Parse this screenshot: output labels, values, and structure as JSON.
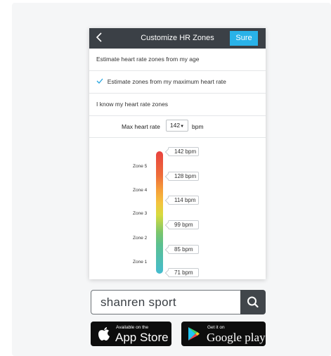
{
  "header": {
    "back_icon": "chevron-left-icon",
    "title": "Customize HR Zones",
    "sure_label": "Sure"
  },
  "options": [
    {
      "label": "Estimate heart rate zones from my age",
      "selected": false
    },
    {
      "label": "Estimate zones from my maximum heart rate",
      "selected": true
    },
    {
      "label": "I know my heart rate zones",
      "selected": false
    }
  ],
  "max_hr": {
    "label": "Max heart rate",
    "value": "142",
    "unit": "bpm"
  },
  "zones": [
    {
      "name": "Zone 5",
      "color": "#e8423f"
    },
    {
      "name": "Zone 4",
      "color": "#f6a13a"
    },
    {
      "name": "Zone 3",
      "color": "#d7db3f"
    },
    {
      "name": "Zone 2",
      "color": "#7dc66b"
    },
    {
      "name": "Zone 1",
      "color": "#45bcd0"
    }
  ],
  "thresholds": [
    "142 bpm",
    "128 bpm",
    "114 bpm",
    "99 bpm",
    "85 bpm",
    "71 bpm"
  ],
  "search": {
    "value": "shanren sport",
    "icon": "search-icon"
  },
  "stores": {
    "appstore_small": "Available on the",
    "appstore_big": "App Store",
    "gplay_small": "Get it on",
    "gplay_big": "Google play"
  },
  "colors": {
    "accent": "#29b2e8",
    "topbar": "#3b4046"
  }
}
